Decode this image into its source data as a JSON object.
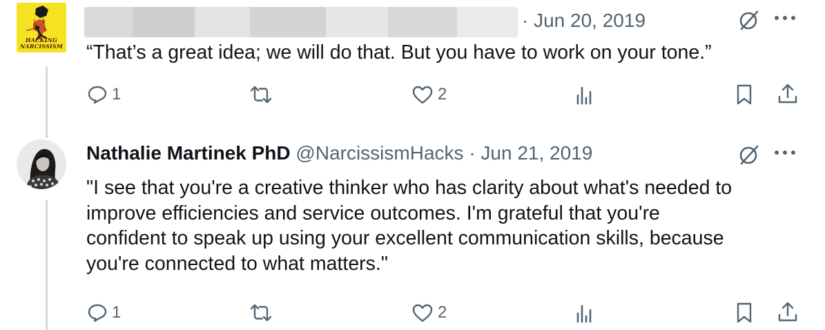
{
  "tweets": [
    {
      "author_name": "",
      "handle": "",
      "avatar_logo_text": [
        "HACKING",
        "NARCISSISM"
      ],
      "date": "· Jun 20, 2019",
      "text": "“That’s a great idea; we will do that. But you have to work on your tone.”",
      "reply_count": "1",
      "retweet_count": "",
      "like_count": "2",
      "views_count": ""
    },
    {
      "author_name": "Nathalie Martinek PhD",
      "handle": "@NarcissismHacks",
      "separator": "·",
      "date": "Jun 21, 2019",
      "text": "\"I see that you're a creative thinker who has clarity about what's needed to\nimprove efficiencies and service outcomes. I'm grateful that you're\nconfident to speak up using your excellent communication skills, because\nyou're connected to what matters.\"",
      "reply_count": "1",
      "retweet_count": "",
      "like_count": "2",
      "views_count": ""
    }
  ],
  "icons": [
    "grok-icon",
    "more-icon",
    "reply-icon",
    "retweet-icon",
    "like-icon",
    "views-icon",
    "bookmark-icon",
    "share-icon"
  ],
  "colors": {
    "text": "#0f1419",
    "muted": "#536471",
    "thread_line": "#cfd9de",
    "logo_bg": "#f5e321"
  }
}
